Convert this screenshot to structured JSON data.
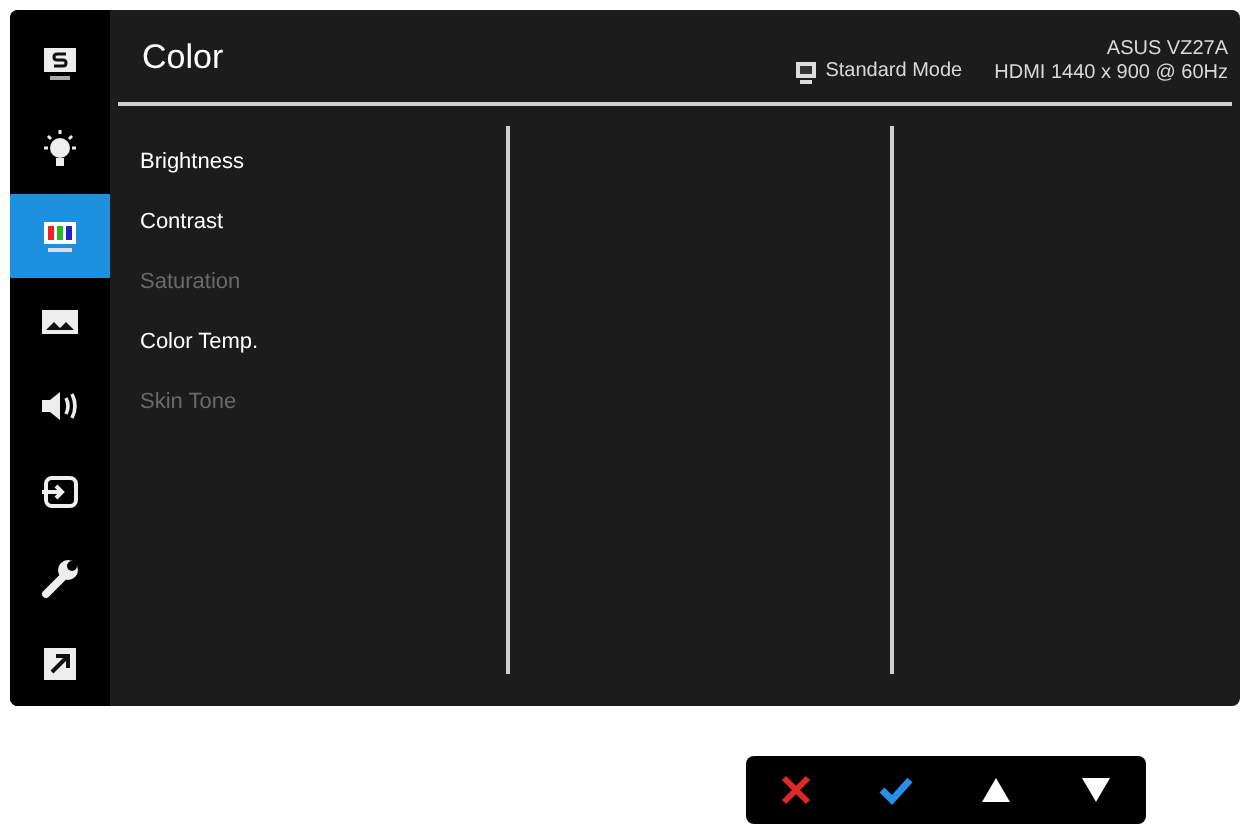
{
  "sidebar": {
    "items": [
      {
        "kind": "splendid",
        "selected": false
      },
      {
        "kind": "bulb",
        "selected": false
      },
      {
        "kind": "color",
        "selected": true
      },
      {
        "kind": "image",
        "selected": false
      },
      {
        "kind": "sound",
        "selected": false
      },
      {
        "kind": "input",
        "selected": false
      },
      {
        "kind": "wrench",
        "selected": false
      },
      {
        "kind": "shortcut",
        "selected": false
      }
    ]
  },
  "header": {
    "title": "Color",
    "mode": "Standard Mode",
    "model": "ASUS VZ27A",
    "signal": "HDMI 1440 x 900 @ 60Hz"
  },
  "menu": {
    "items": [
      {
        "label": "Brightness",
        "disabled": false
      },
      {
        "label": "Contrast",
        "disabled": false
      },
      {
        "label": "Saturation",
        "disabled": true
      },
      {
        "label": "Color Temp.",
        "disabled": false
      },
      {
        "label": "Skin Tone",
        "disabled": true
      }
    ]
  },
  "buttons": [
    {
      "kind": "cancel"
    },
    {
      "kind": "ok"
    },
    {
      "kind": "up"
    },
    {
      "kind": "down"
    }
  ]
}
